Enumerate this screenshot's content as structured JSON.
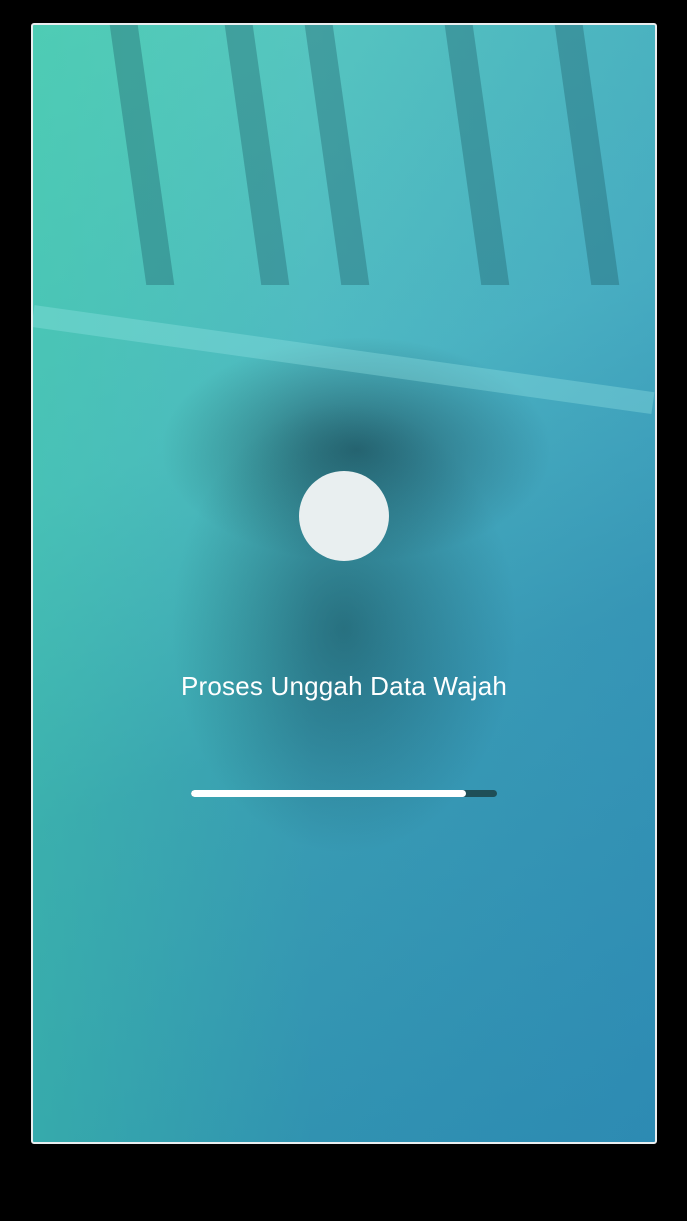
{
  "screen": {
    "status_text": "Proses Unggah Data Wajah",
    "progress": 0.9,
    "indicator_color": "#e9eff0",
    "progress_color": "#ffffff",
    "progress_track_color": "#1f4f57",
    "overlay_colors": [
      "#58c9bf",
      "#2e8fb0"
    ]
  }
}
